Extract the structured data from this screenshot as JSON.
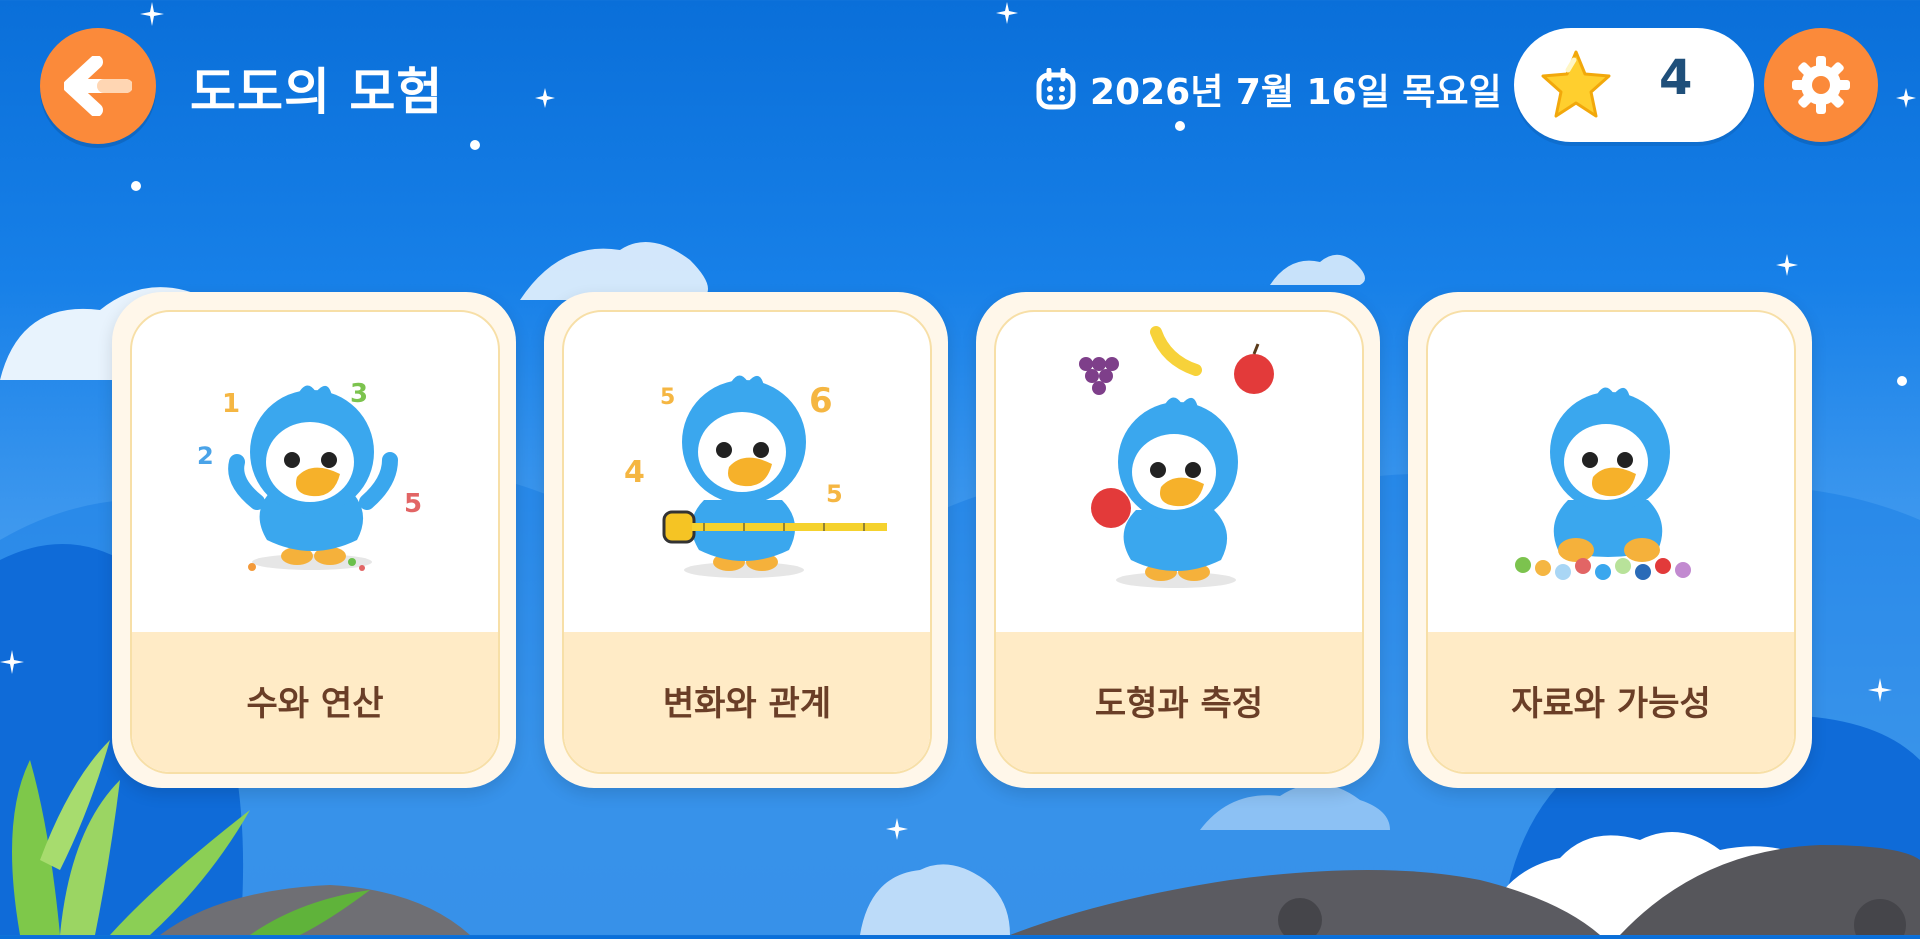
{
  "header": {
    "title": "도도의 모험",
    "date": "2026년 7월 16일 목요일",
    "star_count": "4"
  },
  "icons": {
    "back": "arrow-left-icon",
    "calendar": "calendar-icon",
    "star": "star-icon",
    "settings": "gear-icon"
  },
  "cards": [
    {
      "label": "수와 연산",
      "art": "numbers"
    },
    {
      "label": "변화와 관계",
      "art": "tape-measure"
    },
    {
      "label": "도형과 측정",
      "art": "fruits"
    },
    {
      "label": "자료와 가능성",
      "art": "marbles"
    }
  ],
  "colors": {
    "accent": "#fb8a3a",
    "sky": "#1780e8",
    "card_label_bg": "#ffebc6",
    "card_label_text": "#6a3e27",
    "mascot": "#3aa7ee"
  }
}
